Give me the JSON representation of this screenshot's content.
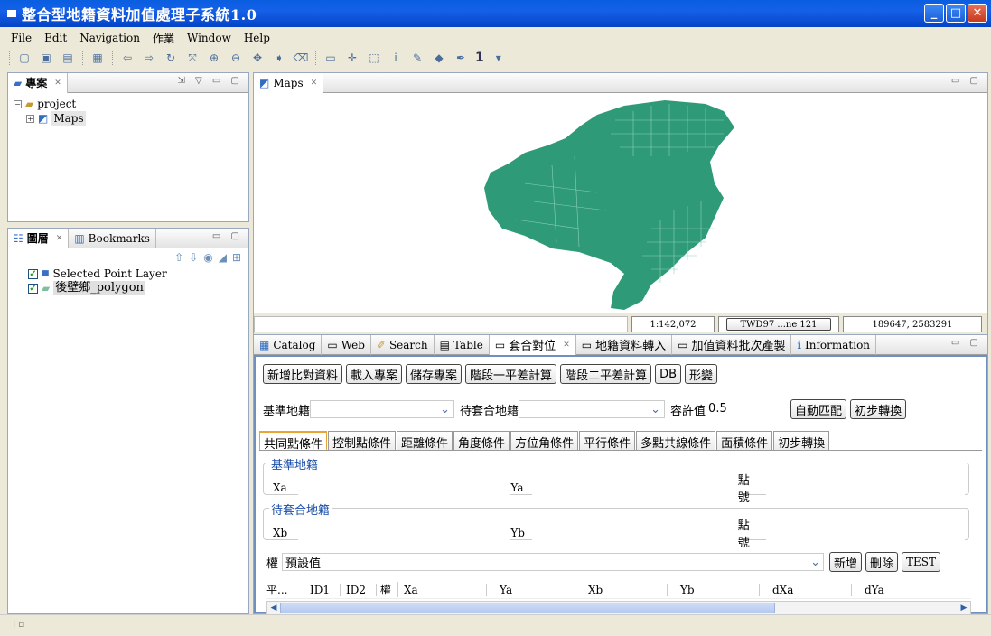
{
  "window": {
    "title": "整合型地籍資料加值處理子系統1.0"
  },
  "menu": [
    "File",
    "Edit",
    "Navigation",
    "作業",
    "Window",
    "Help"
  ],
  "toolbar": {
    "scale_label": "1"
  },
  "project_panel": {
    "tab_label": "專案",
    "tree": [
      {
        "label": "project",
        "icon": "folder-icon"
      },
      {
        "label": "Maps",
        "icon": "map-icon"
      }
    ]
  },
  "layers_panel": {
    "tabs": [
      "圖層",
      "Bookmarks"
    ],
    "layers": [
      "Selected Point Layer",
      "後壁鄉_polygon"
    ]
  },
  "map_view": {
    "tab_label": "Maps",
    "scale": "1:142,072",
    "crs": "TWD97 ...ne 121",
    "coords": "189647, 2583291",
    "fill_color": "#2e9a78"
  },
  "bottom_tabs": [
    "Catalog",
    "Web",
    "Search",
    "Table",
    "套合對位",
    "地籍資料轉入",
    "加值資料批次產製",
    "Information"
  ],
  "bottom_active_tab": "套合對位",
  "action_buttons": [
    "新增比對資料",
    "載入專案",
    "儲存專案",
    "階段一平差計算",
    "階段二平差計算",
    "DB",
    "形變"
  ],
  "params": {
    "base_label": "基準地籍",
    "target_label": "待套合地籍",
    "tolerance_label": "容許值",
    "tolerance_value": "0.5",
    "auto_match": "自動匹配",
    "initial_transform": "初步轉換"
  },
  "condition_tabs": [
    "共同點條件",
    "控制點條件",
    "距離條件",
    "角度條件",
    "方位角條件",
    "平行條件",
    "多點共線條件",
    "面積條件",
    "初步轉換"
  ],
  "base_group": {
    "legend": "基準地籍",
    "x": "Xa",
    "y": "Ya",
    "id": "點號"
  },
  "target_group": {
    "legend": "待套合地籍",
    "x": "Xb",
    "y": "Yb",
    "id": "點號"
  },
  "weight": {
    "label": "權",
    "value": "預設值",
    "add": "新增",
    "delete": "刪除",
    "test": "TEST"
  },
  "table_headers": [
    "平...",
    "ID1",
    "ID2",
    "權",
    "Xa",
    "Ya",
    "Xb",
    "Yb",
    "dXa",
    "dYa"
  ]
}
